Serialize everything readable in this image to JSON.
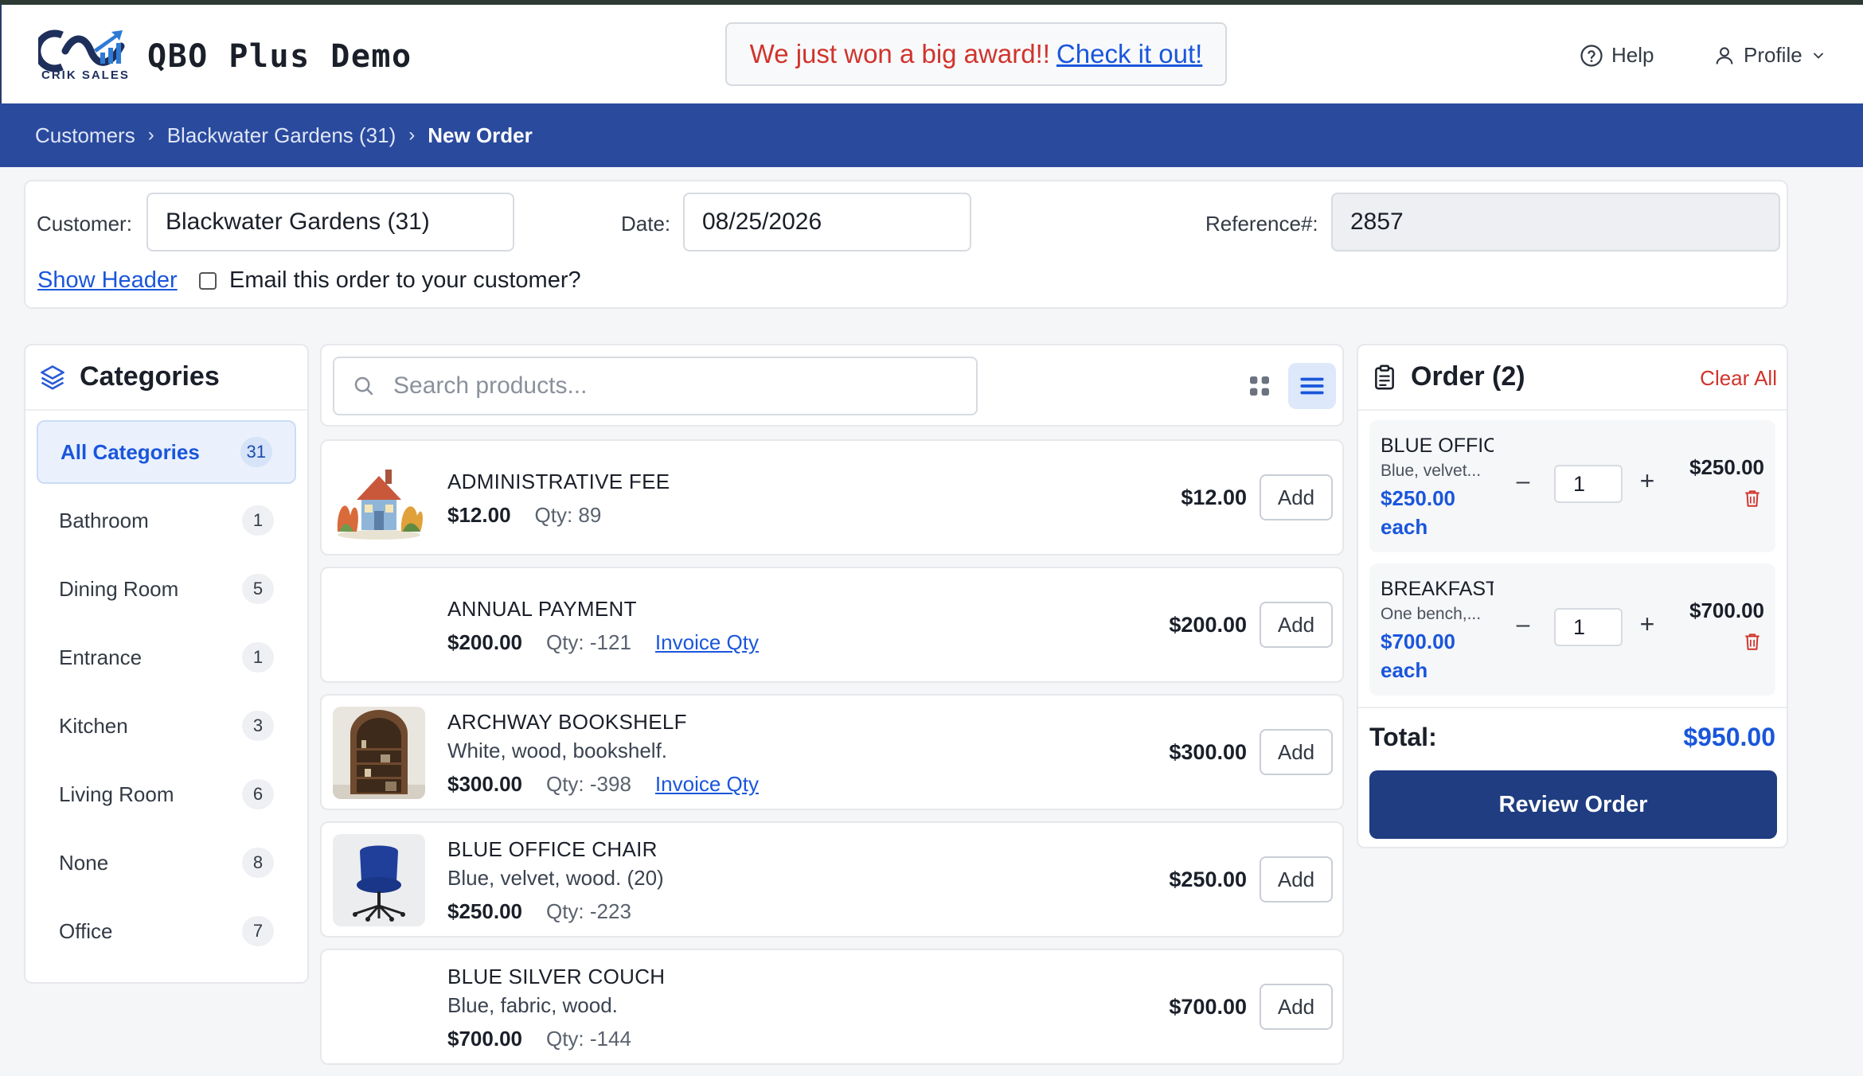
{
  "header": {
    "logo_text": "CRIK SALES",
    "title": "QBO Plus Demo",
    "award_text": "We just won a big award!!",
    "award_link": "Check it out!",
    "help_label": "Help",
    "profile_label": "Profile"
  },
  "breadcrumb": {
    "items": [
      "Customers",
      "Blackwater Gardens (31)"
    ],
    "current": "New Order"
  },
  "order_header": {
    "customer_label": "Customer:",
    "customer_value": "Blackwater Gardens (31)",
    "date_label": "Date:",
    "date_value": "08/25/2026",
    "reference_label": "Reference#:",
    "reference_value": "2857",
    "show_header_link": "Show Header",
    "email_label": "Email this order to your customer?",
    "email_checked": false
  },
  "categories": {
    "title": "Categories",
    "items": [
      {
        "label": "All Categories",
        "count": "31",
        "active": true
      },
      {
        "label": "Bathroom",
        "count": "1"
      },
      {
        "label": "Dining Room",
        "count": "5"
      },
      {
        "label": "Entrance",
        "count": "1"
      },
      {
        "label": "Kitchen",
        "count": "3"
      },
      {
        "label": "Living Room",
        "count": "6"
      },
      {
        "label": "None",
        "count": "8"
      },
      {
        "label": "Office",
        "count": "7"
      }
    ]
  },
  "search": {
    "placeholder": "Search products..."
  },
  "products": [
    {
      "name": "ADMINISTRATIVE FEE",
      "description": "",
      "price": "$12.00",
      "qty": "Qty: 89",
      "invoice_link": "",
      "price_right": "$12.00",
      "add_label": "Add",
      "image": "house-illustration"
    },
    {
      "name": "ANNUAL PAYMENT",
      "description": "",
      "price": "$200.00",
      "qty": "Qty: -121",
      "invoice_link": "Invoice Qty",
      "price_right": "$200.00",
      "add_label": "Add",
      "image": "blank"
    },
    {
      "name": "ARCHWAY BOOKSHELF",
      "description": "White, wood, bookshelf.",
      "price": "$300.00",
      "qty": "Qty: -398",
      "invoice_link": "Invoice Qty",
      "price_right": "$300.00",
      "add_label": "Add",
      "image": "bookshelf-photo"
    },
    {
      "name": "BLUE OFFICE CHAIR",
      "description": "Blue, velvet, wood. (20)",
      "price": "$250.00",
      "qty": "Qty: -223",
      "invoice_link": "",
      "price_right": "$250.00",
      "add_label": "Add",
      "image": "chair-photo"
    },
    {
      "name": "BLUE SILVER COUCH",
      "description": "Blue, fabric, wood.",
      "price": "$700.00",
      "qty": "Qty: -144",
      "invoice_link": "",
      "price_right": "$700.00",
      "add_label": "Add",
      "image": "blank"
    }
  ],
  "order": {
    "title": "Order (2)",
    "clear_label": "Clear All",
    "items": [
      {
        "name": "BLUE OFFICE CHAIR",
        "description": "Blue, velvet...",
        "unit_price": "$250.00",
        "each": "each",
        "qty": "1",
        "line_total": "$250.00"
      },
      {
        "name": "BREAKFAST",
        "description": "One bench,...",
        "unit_price": "$700.00",
        "each": "each",
        "qty": "1",
        "line_total": "$700.00"
      }
    ],
    "total_label": "Total:",
    "total_value": "$950.00",
    "review_label": "Review Order"
  },
  "colors": {
    "brand_blue": "#2a4a9e",
    "link_blue": "#1a56db",
    "danger_red": "#d0342c",
    "review_button": "#1f3d80"
  },
  "icons": [
    "help-circle-icon",
    "user-icon",
    "chevron-down-icon",
    "layers-icon",
    "search-icon",
    "grid-view-icon",
    "list-view-icon",
    "clipboard-icon",
    "trash-icon"
  ]
}
